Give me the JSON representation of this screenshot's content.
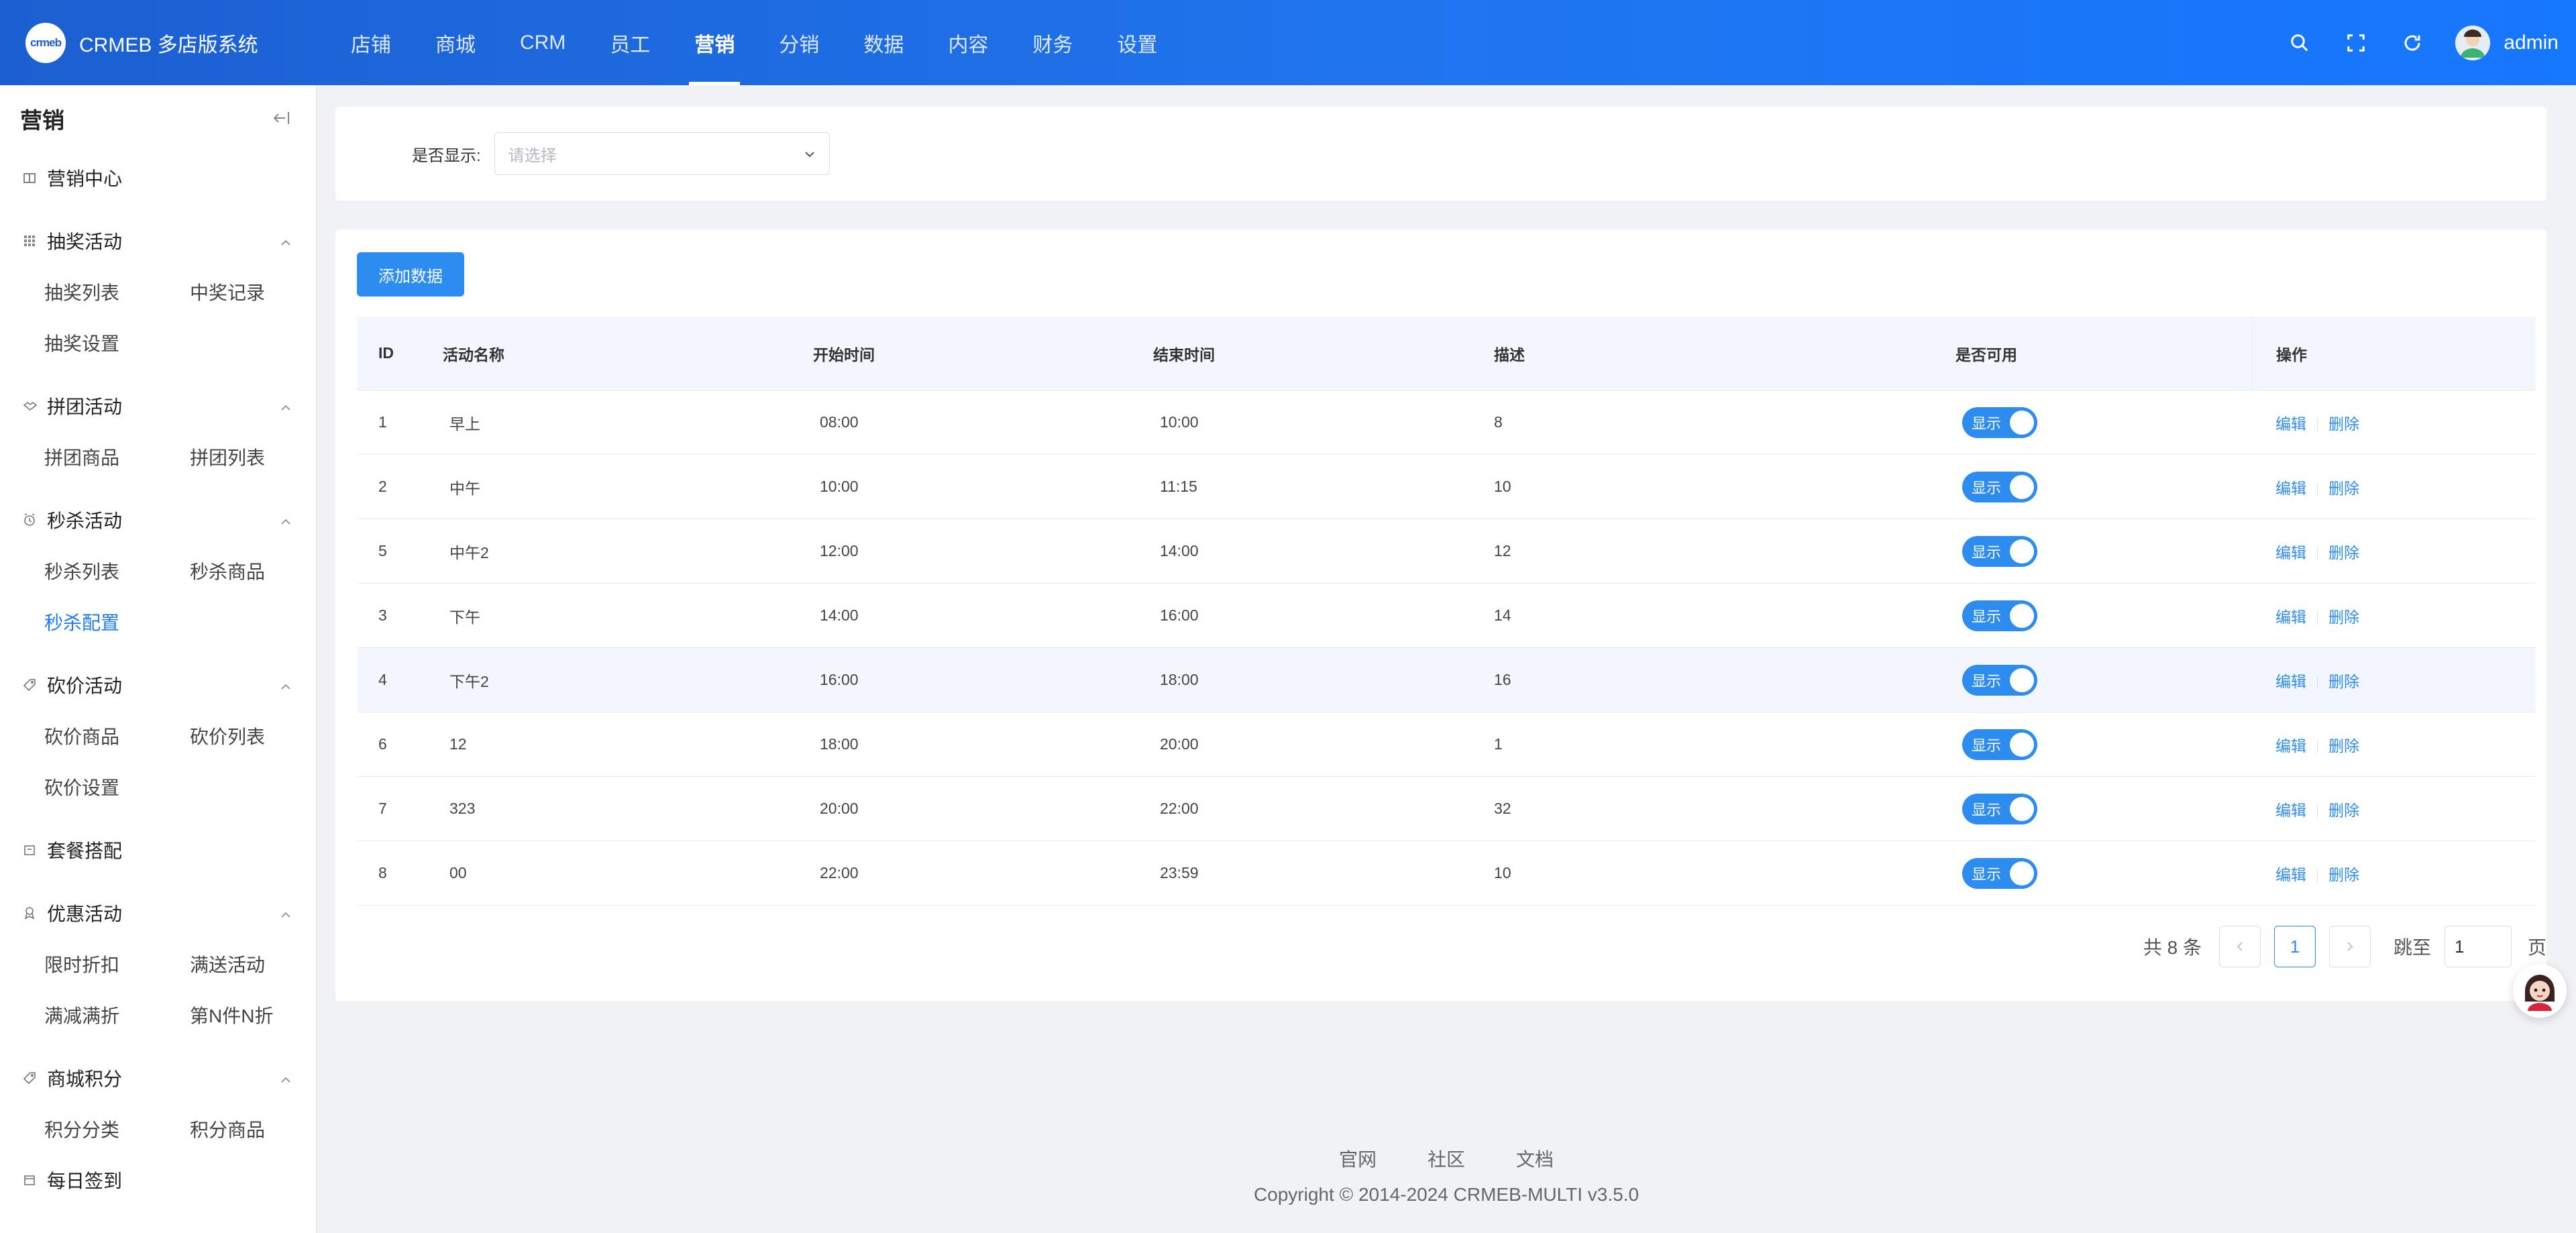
{
  "brand": {
    "logo_text": "crmeb",
    "name": "CRMEB 多店版系统"
  },
  "topnav": [
    "店铺",
    "商城",
    "CRM",
    "员工",
    "营销",
    "分销",
    "数据",
    "内容",
    "财务",
    "设置"
  ],
  "topnav_active": "营销",
  "header": {
    "user": "admin"
  },
  "sidebar": {
    "title": "营销",
    "center": "营销中心",
    "lottery": {
      "label": "抽奖活动",
      "items": [
        "抽奖列表",
        "中奖记录",
        "抽奖设置"
      ]
    },
    "group": {
      "label": "拼团活动",
      "items": [
        "拼团商品",
        "拼团列表"
      ]
    },
    "seckill": {
      "label": "秒杀活动",
      "items": [
        "秒杀列表",
        "秒杀商品",
        "秒杀配置"
      ]
    },
    "bargain": {
      "label": "砍价活动",
      "items": [
        "砍价商品",
        "砍价列表",
        "砍价设置"
      ]
    },
    "combo": "套餐搭配",
    "discount": {
      "label": "优惠活动",
      "items": [
        "限时折扣",
        "满送活动",
        "满减满折",
        "第N件N折"
      ]
    },
    "points": {
      "label": "商城积分",
      "items": [
        "积分分类",
        "积分商品"
      ]
    },
    "signin": "每日签到"
  },
  "filter": {
    "label": "是否显示:",
    "placeholder": "请选择"
  },
  "add_button": "添加数据",
  "table": {
    "headers": {
      "id": "ID",
      "name": "活动名称",
      "start": "开始时间",
      "end": "结束时间",
      "desc": "描述",
      "avail": "是否可用",
      "op": "操作"
    },
    "rows": [
      {
        "id": "1",
        "name": "早上",
        "start": "08:00",
        "end": "10:00",
        "desc": "8",
        "toggle": "显示"
      },
      {
        "id": "2",
        "name": "中午",
        "start": "10:00",
        "end": "11:15",
        "desc": "10",
        "toggle": "显示"
      },
      {
        "id": "5",
        "name": "中午2",
        "start": "12:00",
        "end": "14:00",
        "desc": "12",
        "toggle": "显示"
      },
      {
        "id": "3",
        "name": "下午",
        "start": "14:00",
        "end": "16:00",
        "desc": "14",
        "toggle": "显示"
      },
      {
        "id": "4",
        "name": "下午2",
        "start": "16:00",
        "end": "18:00",
        "desc": "16",
        "toggle": "显示"
      },
      {
        "id": "6",
        "name": "12",
        "start": "18:00",
        "end": "20:00",
        "desc": "1",
        "toggle": "显示"
      },
      {
        "id": "7",
        "name": "323",
        "start": "20:00",
        "end": "22:00",
        "desc": "32",
        "toggle": "显示"
      },
      {
        "id": "8",
        "name": "00",
        "start": "22:00",
        "end": "23:59",
        "desc": "10",
        "toggle": "显示"
      }
    ],
    "edit": "编辑",
    "delete": "删除"
  },
  "pager": {
    "total": "共 8 条",
    "current": "1",
    "jump_label": "跳至",
    "jump_value": "1",
    "page_suffix": "页"
  },
  "footer": {
    "links": [
      "官网",
      "社区",
      "文档"
    ],
    "copyright": "Copyright © 2014-2024 CRMEB-MULTI v3.5.0"
  },
  "colors": {
    "header": "#1c5fd1",
    "accent": "#2d8cf0",
    "active_menu": "#1e7bf4"
  }
}
